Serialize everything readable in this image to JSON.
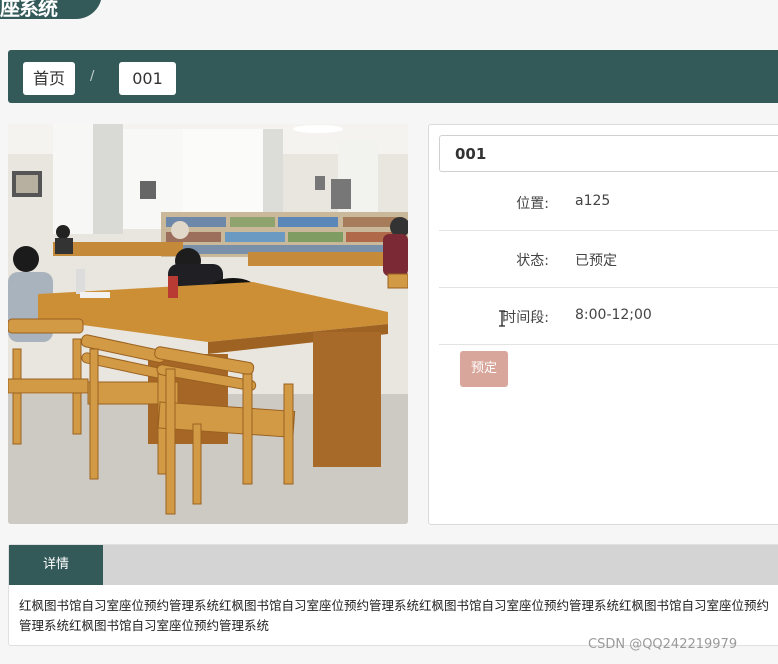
{
  "header": {
    "title": "座系统"
  },
  "breadcrumb": {
    "home": "首页",
    "separator": "/",
    "current": "001"
  },
  "photo": {
    "subject": "library study room with wooden tables and chairs"
  },
  "seat": {
    "title": "001",
    "rows": [
      {
        "label": "位置:",
        "value": "a125"
      },
      {
        "label": "状态:",
        "value": "已预定"
      },
      {
        "label": "时间段:",
        "value": "8:00-12;00"
      }
    ],
    "reserve_label": "预定"
  },
  "detail": {
    "tab_label": "详情",
    "text": "红枫图书馆自习室座位预约管理系统红枫图书馆自习室座位预约管理系统红枫图书馆自习室座位预约管理系统红枫图书馆自习室座位预约管理系统红枫图书馆自习室座位预约管理系统"
  },
  "watermark": "CSDN @QQ242219979",
  "colors": {
    "primary": "#335a58",
    "reserve_button": "#d9a69b",
    "detail_head": "#d4d4d4"
  }
}
